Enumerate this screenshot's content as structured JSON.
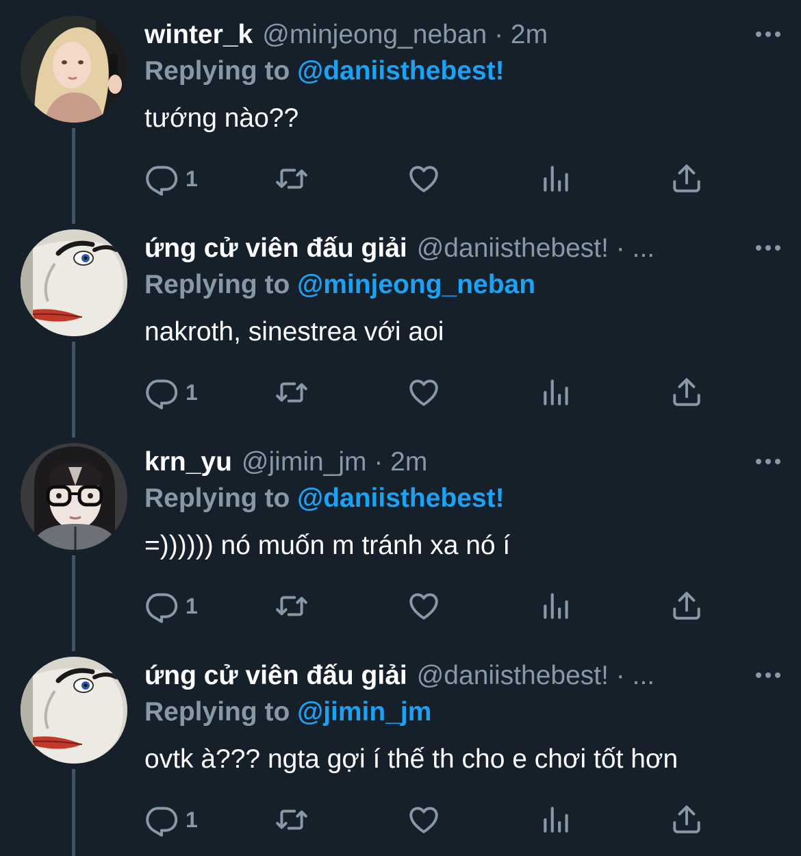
{
  "tweets": [
    {
      "display_name": "winter_k",
      "handle_meta": "@minjeong_neban · 2m",
      "replying_prefix": "Replying to ",
      "replying_to": "@daniisthebest!",
      "text": "tướng nào??",
      "reply_count": "1",
      "avatar": "blonde-girl-avatar"
    },
    {
      "display_name": "ứng cử viên đấu giải",
      "handle_meta": "@daniisthebest! · ...",
      "replying_prefix": "Replying to ",
      "replying_to": "@minjeong_neban",
      "text": "nakroth, sinestrea với aoi",
      "reply_count": "1",
      "avatar": "white-face-meme-avatar"
    },
    {
      "display_name": "krn_yu",
      "handle_meta": "@jimin_jm · 2m",
      "replying_prefix": "Replying to ",
      "replying_to": "@daniisthebest!",
      "text": "=)))))) nó muốn m tránh xa nó í",
      "reply_count": "1",
      "avatar": "girl-with-glasses-avatar"
    },
    {
      "display_name": "ứng cử viên đấu giải",
      "handle_meta": "@daniisthebest! · ...",
      "replying_prefix": "Replying to ",
      "replying_to": "@jimin_jm",
      "text": "ovtk à??? ngta gợi í thế th cho e chơi tốt hơn",
      "reply_count": "1",
      "avatar": "white-face-meme-avatar"
    }
  ],
  "icons": {
    "reply": "reply-icon",
    "retweet": "retweet-icon",
    "like": "like-icon",
    "analytics": "analytics-icon",
    "share": "share-icon",
    "more": "more-icon"
  },
  "colors": {
    "background": "#15202b",
    "secondary_text": "#8899a6",
    "link": "#1da1f2",
    "thread_line": "#3d5466",
    "primary_text": "#ffffff"
  }
}
